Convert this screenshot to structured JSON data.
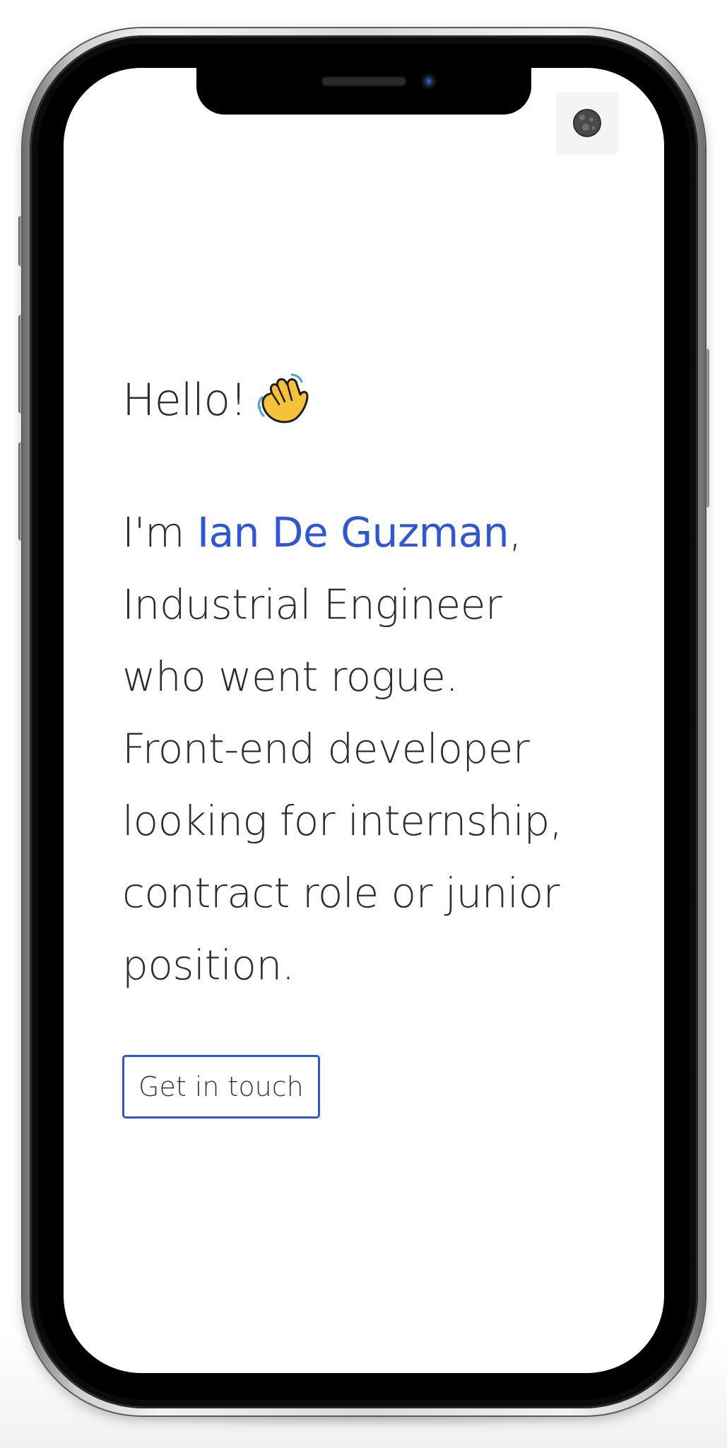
{
  "header": {
    "theme_toggle_icon": "moon-icon"
  },
  "hero": {
    "greeting": "Hello!",
    "greeting_icon": "waving-hand-icon",
    "intro_prefix": "I'm ",
    "name": "Ian De Guzman",
    "intro_line1_suffix": ",",
    "intro_line2": "Industrial Engineer",
    "intro_line3": "who went rogue.",
    "intro_line4": "Front-end developer",
    "intro_line5": "looking for internship,",
    "intro_line6": "contract role or junior",
    "intro_line7": "position.",
    "cta_label": "Get in touch"
  },
  "colors": {
    "accent": "#2f56d6",
    "text": "#2b2b2b",
    "toggle_bg": "#f3f4f6"
  }
}
